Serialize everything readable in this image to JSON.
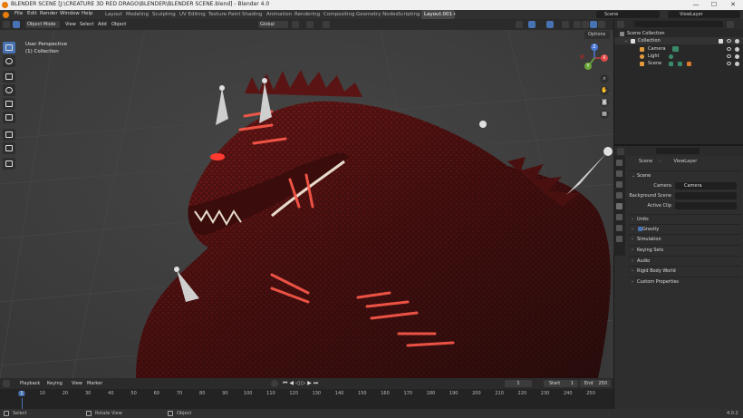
{
  "window": {
    "title": "BLENDER SCENE [J:\\CREATURE 3D RED DRAGO\\BLENDER\\BLENDER SCENE.blend] - Blender 4.0",
    "controls": [
      "—",
      "☐",
      "✕"
    ]
  },
  "menu": [
    "File",
    "Edit",
    "Render",
    "Window",
    "Help"
  ],
  "workspaces": [
    "Layout",
    "Modeling",
    "Sculpting",
    "UV Editing",
    "Texture Paint",
    "Shading",
    "Animation",
    "Rendering",
    "Compositing",
    "Geometry Nodes",
    "Scripting",
    "Layout.001",
    "+"
  ],
  "active_workspace": "Layout.001",
  "scene_selector": "Scene",
  "viewlayer_selector": "ViewLayer",
  "viewport_header": {
    "mode": "Object Mode",
    "menus": [
      "View",
      "Select",
      "Add",
      "Object"
    ],
    "orientation": "Global",
    "options": "Options"
  },
  "viewport": {
    "perspective": "User Perspective",
    "collection": "(1) Collection"
  },
  "nav_gizmo": {
    "x": "X",
    "y": "Y",
    "z": "Z"
  },
  "timeline": {
    "menus": [
      "Playback",
      "Keying",
      "View",
      "Marker"
    ],
    "current_frame": "1",
    "start_label": "Start",
    "start": "1",
    "end_label": "End",
    "end": "250",
    "ticks": [
      "1",
      "10",
      "20",
      "30",
      "40",
      "50",
      "60",
      "70",
      "80",
      "90",
      "100",
      "110",
      "120",
      "130",
      "140",
      "150",
      "160",
      "170",
      "180",
      "190",
      "200",
      "210",
      "220",
      "230",
      "240",
      "250"
    ]
  },
  "status": {
    "select": "Select",
    "rotate": "Rotate View",
    "object": "Object",
    "version": "4.0.2"
  },
  "outliner": {
    "root": "Scene Collection",
    "collection": "Collection",
    "items": [
      "Camera",
      "Light",
      "Scene"
    ]
  },
  "properties": {
    "crumb_scene": "Scene",
    "crumb_viewlayer": "ViewLayer",
    "section_scene": "Scene",
    "camera_label": "Camera",
    "camera_value": "Camera",
    "bg_label": "Background Scene",
    "clip_label": "Active Clip",
    "sections": [
      "Units",
      "Gravity",
      "Simulation",
      "Keying Sets",
      "Audio",
      "Rigid Body World",
      "Custom Properties"
    ]
  },
  "colors": {
    "accent": "#4772b3",
    "viewport_bg": "#3d3d3d",
    "dragon_dark": "#2a0d0d",
    "dragon_red": "#8e1e1e",
    "glow": "#ff5a4a"
  }
}
